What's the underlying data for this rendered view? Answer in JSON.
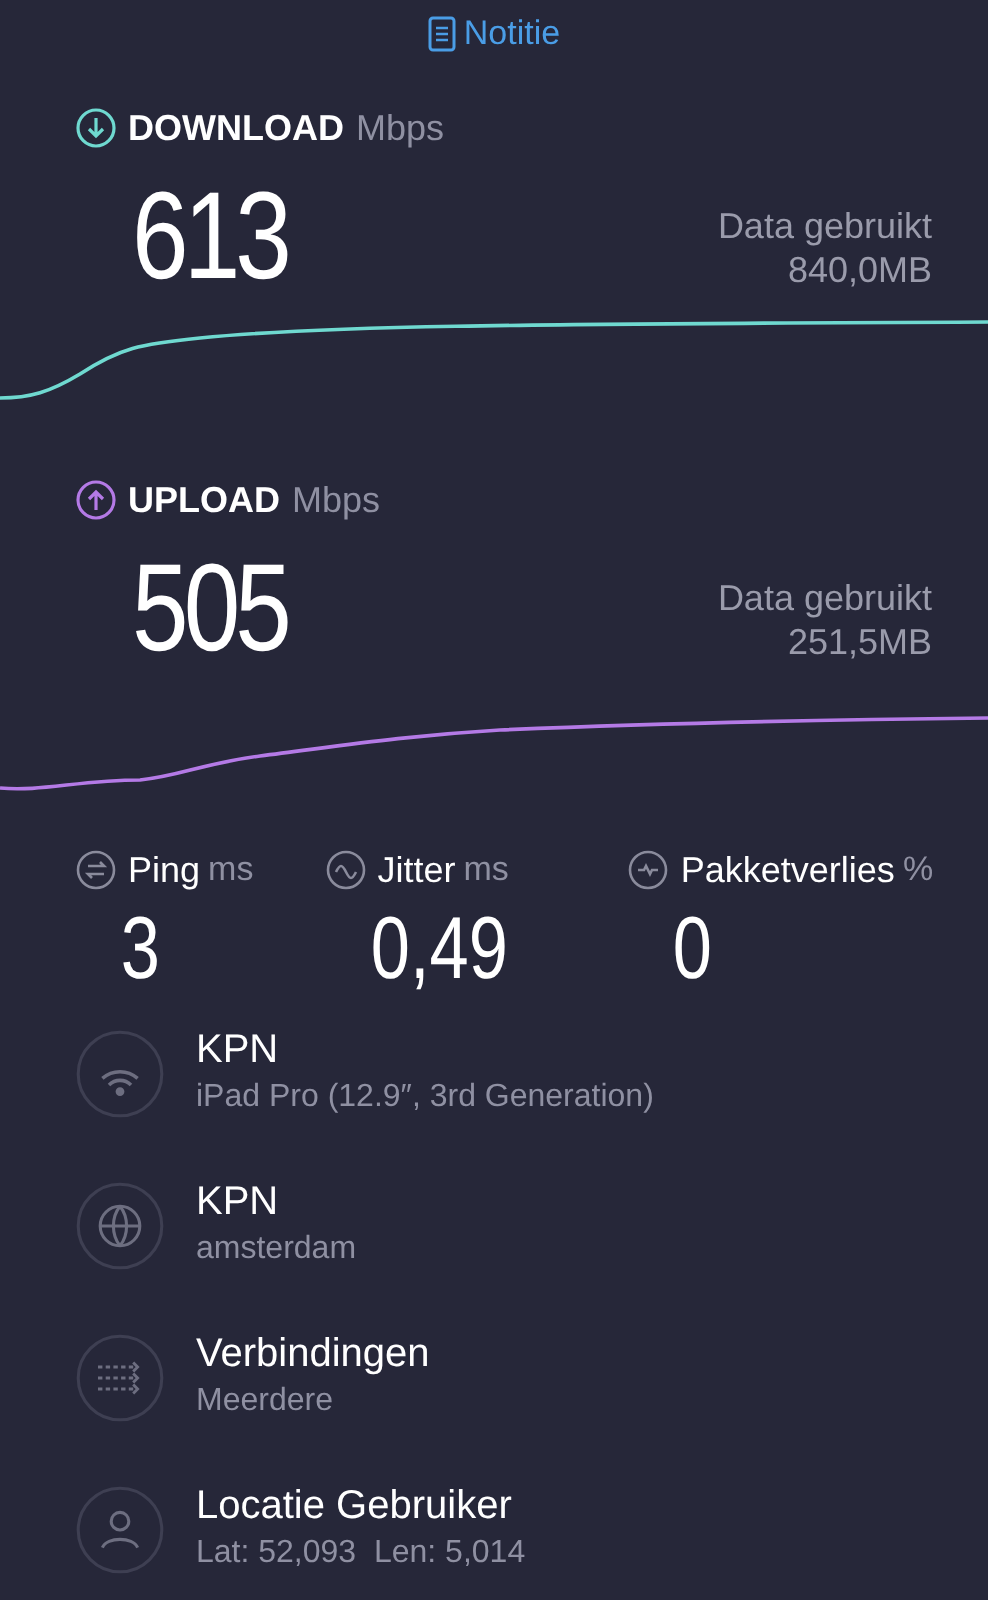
{
  "note_button": {
    "label": "Notitie"
  },
  "speeds": [
    {
      "kind": "download",
      "label": "DOWNLOAD",
      "unit": "Mbps",
      "value": "613",
      "data_label": "Data gebruikt",
      "data_value": "840,0MB"
    },
    {
      "kind": "upload",
      "label": "UPLOAD",
      "unit": "Mbps",
      "value": "505",
      "data_label": "Data gebruikt",
      "data_value": "251,5MB"
    }
  ],
  "metrics": [
    {
      "kind": "ping",
      "label": "Ping",
      "unit": "ms",
      "value": "3"
    },
    {
      "kind": "jitter",
      "label": "Jitter",
      "unit": "ms",
      "value": "0,49"
    },
    {
      "kind": "loss",
      "label": "Pakketverlies",
      "unit": "%",
      "value": "0"
    }
  ],
  "info": [
    {
      "kind": "wifi",
      "title": "KPN",
      "subtitle": "iPad Pro (12.9″, 3rd Generation)"
    },
    {
      "kind": "globe",
      "title": "KPN",
      "subtitle": "amsterdam"
    },
    {
      "kind": "connections",
      "title": "Verbindingen",
      "subtitle": "Meerdere"
    },
    {
      "kind": "user",
      "title": "Locatie Gebruiker",
      "subtitle": "Lat: 52,093  Len: 5,014"
    }
  ]
}
